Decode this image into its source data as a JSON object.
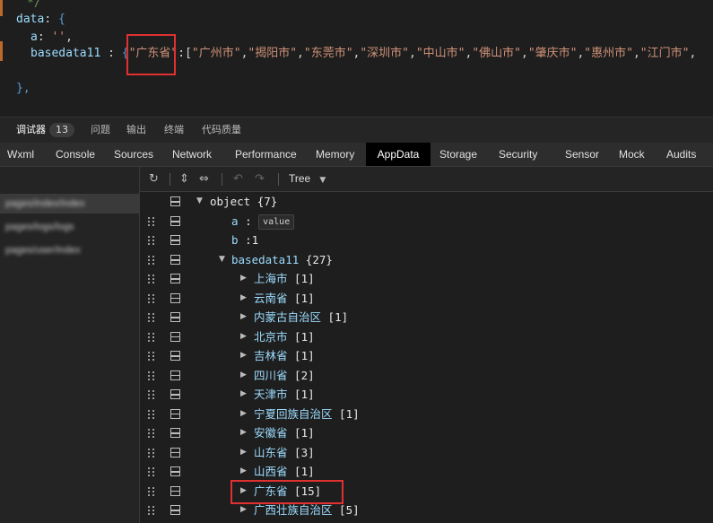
{
  "editor": {
    "comment": "*/",
    "data_key": "data",
    "a_key": "a",
    "a_value": "''",
    "basedata_key": "basedata11",
    "province": "\"广东省\"",
    "cities_prefix": ":[",
    "cities": [
      "\"广州市\"",
      "\"揭阳市\"",
      "\"东莞市\"",
      "\"深圳市\"",
      "\"中山市\"",
      "\"佛山市\"",
      "\"肇庆市\"",
      "\"惠州市\"",
      "\"江门市\""
    ],
    "closing": "},"
  },
  "panel_tabs": {
    "debugger": "调试器",
    "debugger_count": "13",
    "issues": "问题",
    "output": "输出",
    "terminal": "终端",
    "code_quality": "代码质量"
  },
  "devtools_tabs": [
    "Wxml",
    "Console",
    "Sources",
    "Network",
    "Performance",
    "Memory",
    "AppData",
    "Storage",
    "Security",
    "Sensor",
    "Mock",
    "Audits"
  ],
  "active_devtools_tab": "AppData",
  "sidebar": {
    "items": [
      "pages/index/index",
      "pages/logs/logs",
      "pages/user/index"
    ]
  },
  "toolbar": {
    "refresh_icon": "↻",
    "expand_icon": "⇕",
    "collapse_icon": "⇔",
    "undo_icon": "↶",
    "redo_icon": "↷",
    "view_mode": "Tree",
    "dropdown_icon": "▼"
  },
  "tree": {
    "root_label": "object",
    "root_count": "{7}",
    "a_key": "a",
    "a_value": "value",
    "b_key": "b",
    "b_value": "1",
    "basedata_key": "basedata11",
    "basedata_count": "{27}",
    "provinces": [
      {
        "name": "上海市",
        "count": "[1]"
      },
      {
        "name": "云南省",
        "count": "[1]"
      },
      {
        "name": "内蒙古自治区",
        "count": "[1]"
      },
      {
        "name": "北京市",
        "count": "[1]"
      },
      {
        "name": "吉林省",
        "count": "[1]"
      },
      {
        "name": "四川省",
        "count": "[2]"
      },
      {
        "name": "天津市",
        "count": "[1]"
      },
      {
        "name": "宁夏回族自治区",
        "count": "[1]"
      },
      {
        "name": "安徽省",
        "count": "[1]"
      },
      {
        "name": "山东省",
        "count": "[3]"
      },
      {
        "name": "山西省",
        "count": "[1]"
      },
      {
        "name": "广东省",
        "count": "[15]"
      },
      {
        "name": "广西壮族自治区",
        "count": "[5]"
      }
    ]
  },
  "colors": {
    "highlight": "#e03030",
    "key": "#9cdcfe",
    "string": "#ce9178"
  }
}
